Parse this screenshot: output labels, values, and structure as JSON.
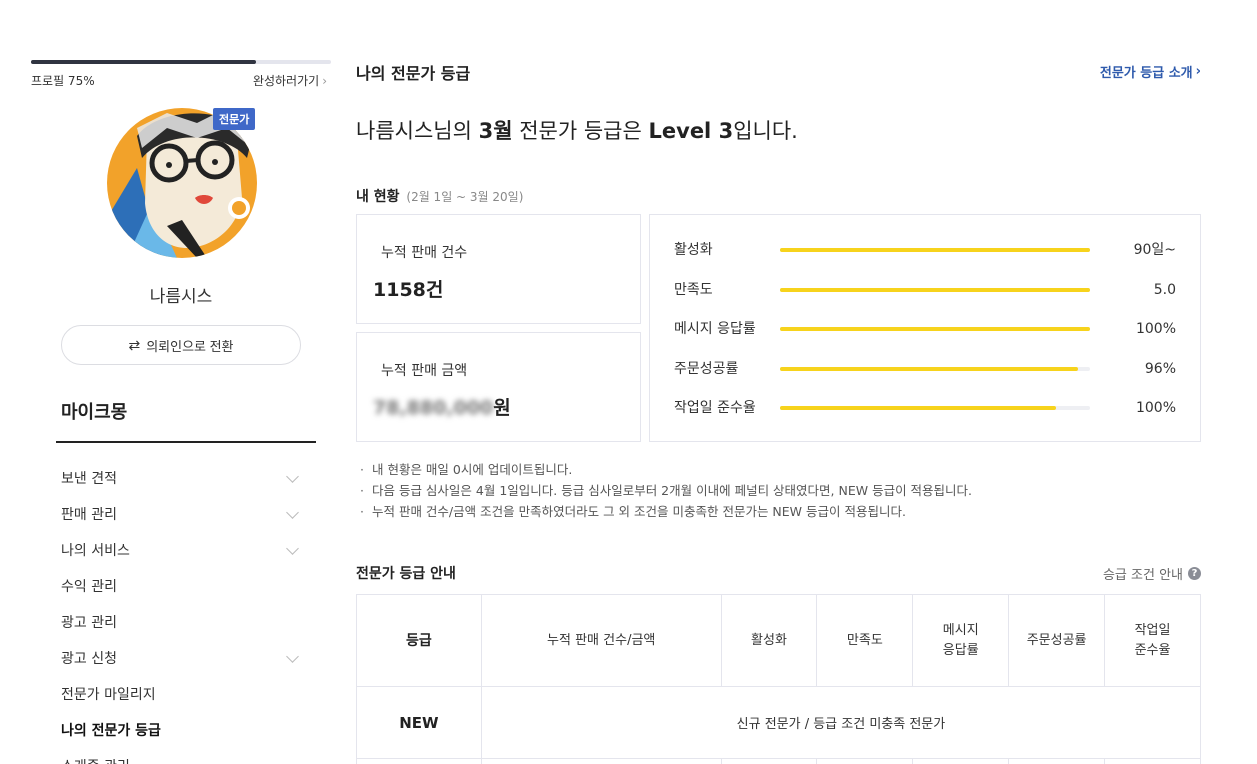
{
  "sidebar": {
    "profile_progress_label": "프로필 75%",
    "profile_progress": 0.75,
    "complete_link": "완성하러가기",
    "expert_badge": "전문가",
    "username": "나름시스",
    "switch_button": "의뢰인으로 전환",
    "shop_title": "마이크몽",
    "menu": [
      {
        "label": "보낸 견적",
        "expandable": true
      },
      {
        "label": "판매 관리",
        "expandable": true
      },
      {
        "label": "나의 서비스",
        "expandable": true
      },
      {
        "label": "수익 관리",
        "expandable": false
      },
      {
        "label": "광고 관리",
        "expandable": false
      },
      {
        "label": "광고 신청",
        "expandable": true
      },
      {
        "label": "전문가 마일리지",
        "expandable": false
      },
      {
        "label": "나의 전문가 등급",
        "expandable": false,
        "active": true
      },
      {
        "label": "소개증 관리",
        "expandable": false
      }
    ]
  },
  "main": {
    "page_title": "나의 전문가 등급",
    "intro_link": "전문가 등급 소개",
    "headline": {
      "name_suffix": "나름시스님의 ",
      "month": "3월",
      "middle": " 전문가 등급은 ",
      "level": "Level 3",
      "end": "입니다."
    },
    "status": {
      "title": "내 현황",
      "period": "(2월 1일 ~ 3월 20일)",
      "cumulative_count_label": "누적 판매 건수",
      "cumulative_count_value": "1158건",
      "cumulative_amount_label": "누적 판매 금액",
      "cumulative_amount_masked": "78,880,000",
      "cumulative_amount_unit": "원"
    },
    "metrics": [
      {
        "label": "활성화",
        "value": "90일~",
        "fill": 1.0
      },
      {
        "label": "만족도",
        "value": "5.0",
        "fill": 1.0
      },
      {
        "label": "메시지 응답률",
        "value": "100%",
        "fill": 1.0
      },
      {
        "label": "주문성공률",
        "value": "96%",
        "fill": 0.96
      },
      {
        "label": "작업일 준수율",
        "value": "100%",
        "fill": 0.89
      }
    ],
    "notes": [
      "내 현황은 매일 0시에 업데이트됩니다.",
      "다음 등급 심사일은 4월 1일입니다. 등급 심사일로부터 2개월 이내에 페널티 상태였다면, NEW 등급이 적용됩니다.",
      "누적 판매 건수/금액 조건을 만족하였더라도 그 외 조건을 미충족한 전문가는 NEW 등급이 적용됩니다."
    ],
    "guide": {
      "title": "전문가 등급 안내",
      "link": "승급 조건 안내",
      "help_icon": "?",
      "headers": [
        "등급",
        "누적 판매 건수/금액",
        "활성화",
        "만족도",
        "메시지 응답률",
        "주문성공률",
        "작업일 준수율"
      ],
      "rows": [
        {
          "grade": "NEW",
          "description": "신규 전문가 / 등급 조건 미충족 전문가"
        }
      ]
    }
  },
  "colors": {
    "accent_blue": "#2e5aac",
    "badge_blue": "#3f68c8",
    "metric_yellow": "#f7d31c",
    "progress_dark": "#303441"
  },
  "icons": {
    "chevron_right": "chevron-right-icon",
    "chevron_down": "chevron-down-icon",
    "swap": "swap-arrows-icon",
    "help": "help-circle-icon"
  }
}
